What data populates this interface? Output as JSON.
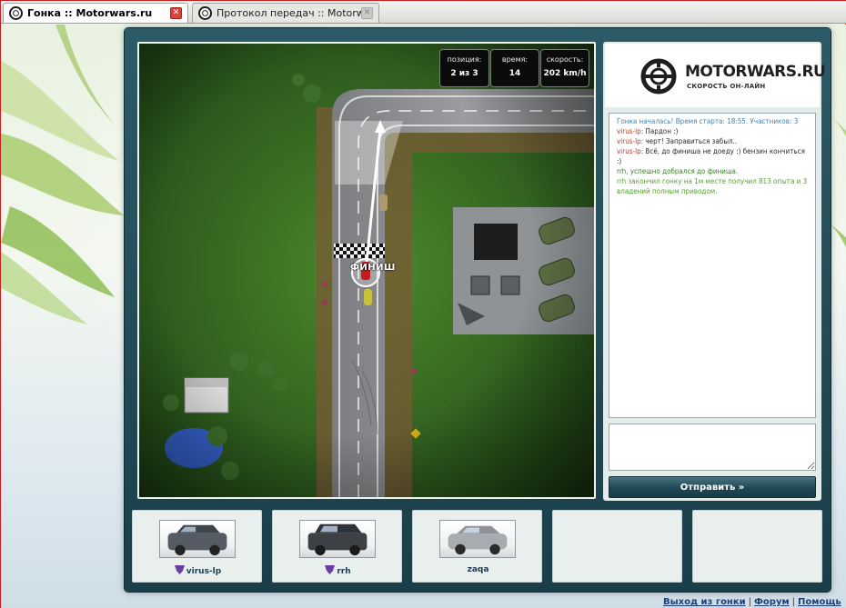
{
  "browser": {
    "tabs": [
      {
        "title": "Гонка :: Motorwars.ru",
        "active": true
      },
      {
        "title": "Протокол передач :: Motorwars.ru",
        "active": false
      }
    ]
  },
  "hud": {
    "position_label": "позиция:",
    "position_value": "2 из 3",
    "time_label": "время:",
    "time_value": "14",
    "speed_label": "скорость:",
    "speed_value": "202 km/h"
  },
  "map": {
    "finish_label": "ФИНИШ"
  },
  "logo": {
    "name": "MOTORWARS.RU",
    "slogan": "СКОРОСТЬ ОН-ЛАЙН"
  },
  "chat": {
    "messages": [
      {
        "type": "system",
        "text": "Гонка началась! Время старта: 18:55. Участников: 3"
      },
      {
        "type": "chat",
        "nick": "virus-lp:",
        "text": "Пардон :)"
      },
      {
        "type": "chat",
        "nick": "virus-lp:",
        "text": "черт! Заправиться забыл.."
      },
      {
        "type": "chat",
        "nick": "virus-lp:",
        "text": "Всё, до финиша не доеду :) бензин кончиться :)"
      },
      {
        "type": "finish",
        "nick": "rrh,",
        "text": "успешно добрался до финиша."
      },
      {
        "type": "win",
        "text": "rrh закончил гонку на 1м месте получил 813 опыта и 3 владений полным приводом."
      }
    ],
    "input_value": "",
    "send_label": "Отправить »"
  },
  "players": [
    {
      "name": "virus-lp",
      "has_clan_icon": true,
      "car_color": "#555b63"
    },
    {
      "name": "rrh",
      "has_clan_icon": true,
      "car_color": "#3d4146"
    },
    {
      "name": "zaqa",
      "has_clan_icon": false,
      "car_color": "#a8acb0"
    },
    {
      "name": "",
      "has_clan_icon": false
    },
    {
      "name": "",
      "has_clan_icon": false
    }
  ],
  "footer": {
    "exit_label": "Выход из гонки",
    "forum_label": "Форум",
    "help_label": "Помощь",
    "separator": "|"
  },
  "colors": {
    "accent": "#1f4854",
    "system_text": "#3a84b8",
    "win_text": "#52a52d",
    "nick_red": "#b03a2a"
  }
}
